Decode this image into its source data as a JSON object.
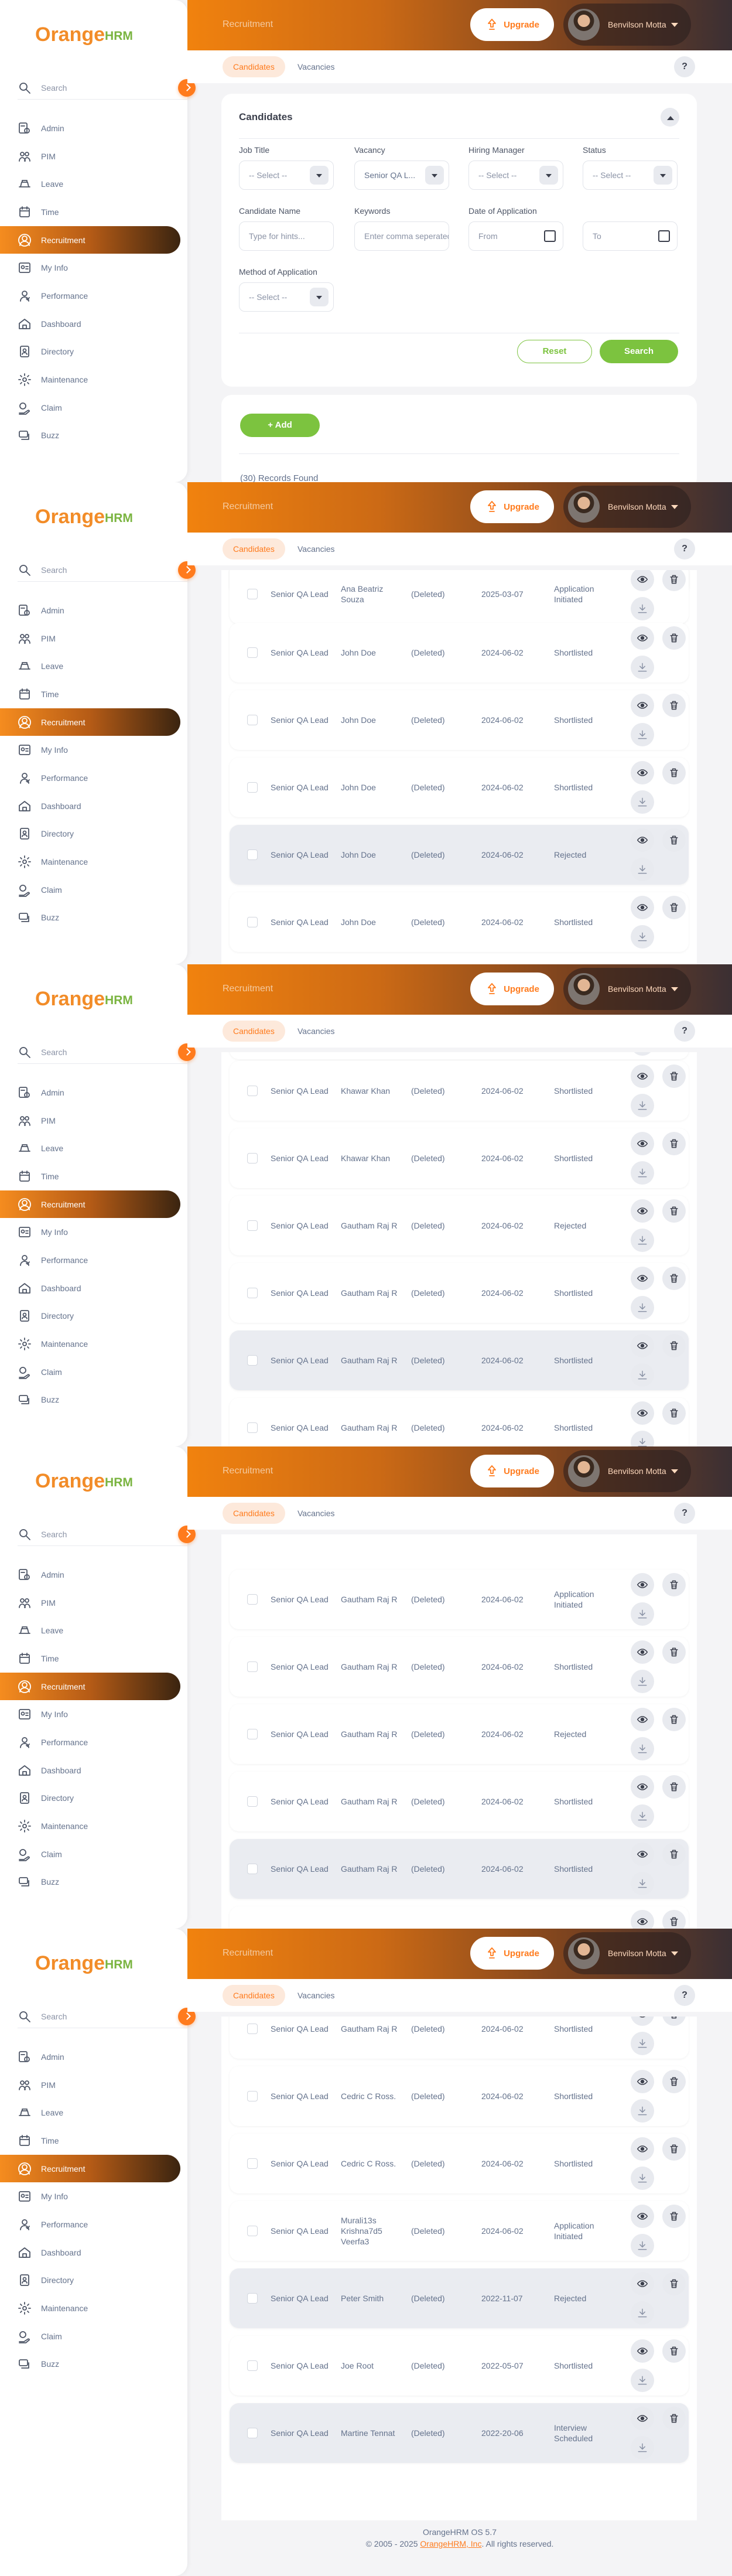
{
  "app": {
    "logo_main": "Orange",
    "logo_hrm": "HRM",
    "breadcrumb": "Recruitment",
    "upgrade_label": "Upgrade",
    "user_name": "Benvilson Motta"
  },
  "sidebar": {
    "search_placeholder": "Search",
    "items": [
      {
        "label": "Admin",
        "icon": "admin-icon"
      },
      {
        "label": "PIM",
        "icon": "pim-icon"
      },
      {
        "label": "Leave",
        "icon": "leave-icon"
      },
      {
        "label": "Time",
        "icon": "time-icon"
      },
      {
        "label": "Recruitment",
        "icon": "recruitment-icon",
        "active": true
      },
      {
        "label": "My Info",
        "icon": "my-info-icon"
      },
      {
        "label": "Performance",
        "icon": "performance-icon"
      },
      {
        "label": "Dashboard",
        "icon": "dashboard-icon"
      },
      {
        "label": "Directory",
        "icon": "directory-icon"
      },
      {
        "label": "Maintenance",
        "icon": "maintenance-icon"
      },
      {
        "label": "Claim",
        "icon": "claim-icon"
      },
      {
        "label": "Buzz",
        "icon": "buzz-icon"
      }
    ]
  },
  "tabs": {
    "candidates": "Candidates",
    "vacancies": "Vacancies",
    "help": "?"
  },
  "filter": {
    "title": "Candidates",
    "job_title_label": "Job Title",
    "job_title_value": "-- Select --",
    "vacancy_label": "Vacancy",
    "vacancy_value": "Senior QA L...",
    "hiring_manager_label": "Hiring Manager",
    "hiring_manager_value": "-- Select --",
    "status_label": "Status",
    "status_value": "-- Select --",
    "candidate_name_label": "Candidate Name",
    "candidate_name_placeholder": "Type for hints...",
    "keywords_label": "Keywords",
    "keywords_placeholder": "Enter comma seperated words...",
    "date_label": "Date of Application",
    "date_from": "From",
    "date_to": "To",
    "method_label": "Method of Application",
    "method_value": "-- Select --",
    "reset_label": "Reset",
    "search_label": "Search"
  },
  "list": {
    "add_label": "+ Add",
    "records_found": "(30) Records Found"
  },
  "rows": [
    {
      "vacancy": "Senior QA Lead",
      "candidate": "Ana Beatriz Souza",
      "manager": "(Deleted)",
      "date": "2025-03-07",
      "status": "Application Initiated"
    },
    {
      "vacancy": "Senior QA Lead",
      "candidate": "Ana Beatriz Souza",
      "manager": "(Deleted)",
      "date": "2025-03-07",
      "status": "Application Initiated"
    },
    {
      "vacancy": "Senior QA Lead",
      "candidate": "John Doe",
      "manager": "(Deleted)",
      "date": "2024-06-02",
      "status": "Shortlisted"
    },
    {
      "vacancy": "Senior QA Lead",
      "candidate": "John Doe",
      "manager": "(Deleted)",
      "date": "2024-06-02",
      "status": "Shortlisted"
    },
    {
      "vacancy": "Senior QA Lead",
      "candidate": "John Doe",
      "manager": "(Deleted)",
      "date": "2024-06-02",
      "status": "Shortlisted"
    },
    {
      "vacancy": "Senior QA Lead",
      "candidate": "John Doe",
      "manager": "(Deleted)",
      "date": "2024-06-02",
      "status": "Rejected"
    },
    {
      "vacancy": "Senior QA Lead",
      "candidate": "John Doe",
      "manager": "(Deleted)",
      "date": "2024-06-02",
      "status": "Shortlisted"
    },
    {
      "vacancy": "Senior QA Lead",
      "candidate": "Khawar Khan",
      "manager": "(Deleted)",
      "date": "2024-06-02",
      "status": "Shortlisted"
    },
    {
      "vacancy": "Senior QA Lead",
      "candidate": "Khawar Khan",
      "manager": "(Deleted)",
      "date": "2024-06-02",
      "status": "Shortlisted"
    },
    {
      "vacancy": "Senior QA Lead",
      "candidate": "Gautham Raj R",
      "manager": "(Deleted)",
      "date": "2024-06-02",
      "status": "Rejected"
    },
    {
      "vacancy": "Senior QA Lead",
      "candidate": "Gautham Raj R",
      "manager": "(Deleted)",
      "date": "2024-06-02",
      "status": "Shortlisted"
    },
    {
      "vacancy": "Senior QA Lead",
      "candidate": "Gautham Raj R",
      "manager": "(Deleted)",
      "date": "2024-06-02",
      "status": "Shortlisted"
    },
    {
      "vacancy": "Senior QA Lead",
      "candidate": "Gautham Raj R",
      "manager": "(Deleted)",
      "date": "2024-06-02",
      "status": "Shortlisted"
    },
    {
      "vacancy": "Senior QA Lead",
      "candidate": "Gautham Raj R",
      "manager": "(Deleted)",
      "date": "2024-06-02",
      "status": "Application Initiated"
    },
    {
      "vacancy": "Senior QA Lead",
      "candidate": "Gautham Raj R",
      "manager": "(Deleted)",
      "date": "2024-06-02",
      "status": "Shortlisted"
    },
    {
      "vacancy": "Senior QA Lead",
      "candidate": "Gautham Raj R",
      "manager": "(Deleted)",
      "date": "2024-06-02",
      "status": "Rejected"
    },
    {
      "vacancy": "Senior QA Lead",
      "candidate": "Gautham Raj R",
      "manager": "(Deleted)",
      "date": "2024-06-02",
      "status": "Shortlisted"
    },
    {
      "vacancy": "Senior QA Lead",
      "candidate": "Gautham Raj R",
      "manager": "(Deleted)",
      "date": "2024-06-02",
      "status": "Shortlisted"
    },
    {
      "vacancy": "Senior QA Lead",
      "candidate": "Gautham Raj R",
      "manager": "(Deleted)",
      "date": "2024-06-02",
      "status": "Shortlisted"
    },
    {
      "vacancy": "Senior QA Lead",
      "candidate": "Gautham Raj R",
      "manager": "(Deleted)",
      "date": "2024-06-02",
      "status": "Shortlisted"
    },
    {
      "vacancy": "Senior QA Lead",
      "candidate": "Cedric C Ross.",
      "manager": "(Deleted)",
      "date": "2024-06-02",
      "status": "Shortlisted"
    },
    {
      "vacancy": "Senior QA Lead",
      "candidate": "Cedric C Ross.",
      "manager": "(Deleted)",
      "date": "2024-06-02",
      "status": "Shortlisted"
    },
    {
      "vacancy": "Senior QA Lead",
      "candidate": "Murali13s Krishna7d5 Veerfa3",
      "manager": "(Deleted)",
      "date": "2024-06-02",
      "status": "Application Initiated"
    },
    {
      "vacancy": "Senior QA Lead",
      "candidate": "Peter Smith",
      "manager": "(Deleted)",
      "date": "2022-11-07",
      "status": "Rejected"
    },
    {
      "vacancy": "Senior QA Lead",
      "candidate": "Joe Root",
      "manager": "(Deleted)",
      "date": "2022-05-07",
      "status": "Shortlisted"
    },
    {
      "vacancy": "Senior QA Lead",
      "candidate": "Martine Tennat",
      "manager": "(Deleted)",
      "date": "2022-20-06",
      "status": "Interview Scheduled"
    }
  ],
  "footer": {
    "version": "OrangeHRM OS 5.7",
    "copyright_prefix": "© 2005 - 2025 ",
    "company": "OrangeHRM, Inc",
    "copyright_suffix": ". All rights reserved."
  }
}
